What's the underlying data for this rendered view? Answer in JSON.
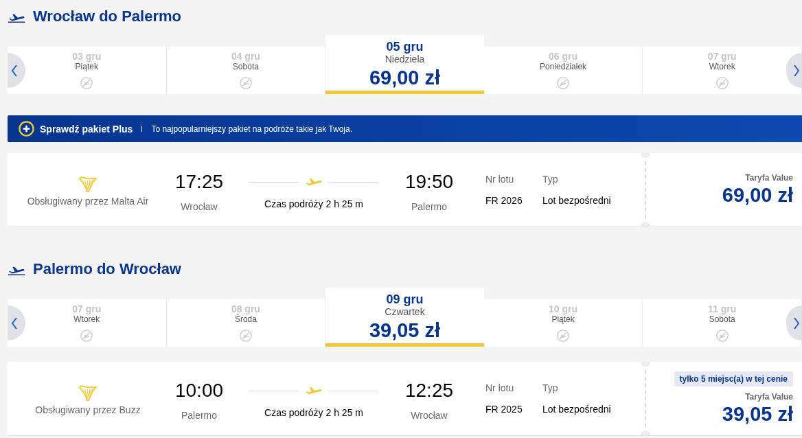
{
  "journeys": [
    {
      "title": "Wrocław do Palermo",
      "dates": [
        {
          "date": "03 gru",
          "day": "Piątek",
          "selected": false
        },
        {
          "date": "04 gru",
          "day": "Sobota",
          "selected": false
        },
        {
          "date": "05 gru",
          "day": "Niedziela",
          "selected": true,
          "price": "69,00 zł"
        },
        {
          "date": "06 gru",
          "day": "Poniedziałek",
          "selected": false
        },
        {
          "date": "07 gru",
          "day": "Wtorek",
          "selected": false
        }
      ],
      "promo": {
        "title": "Sprawdź pakiet Plus",
        "text": "To najpopularniejszy pakiet na podróże takie jak Twoja."
      },
      "flights": [
        {
          "operator": "Obsługiwany przez Malta Air",
          "departure_time": "17:25",
          "departure_city": "Wrocław",
          "duration": "Czas podróży 2 h 25 m",
          "arrival_time": "19:50",
          "arrival_city": "Palermo",
          "flight_number_label": "Nr lotu",
          "flight_number": "FR 2026",
          "type_label": "Typ",
          "type": "Lot bezpośredni",
          "fare": "Taryfa Value",
          "price": "69,00 zł"
        }
      ]
    },
    {
      "title": "Palermo do Wrocław",
      "dates": [
        {
          "date": "07 gru",
          "day": "Wtorek",
          "selected": false
        },
        {
          "date": "08 gru",
          "day": "Środa",
          "selected": false
        },
        {
          "date": "09 gru",
          "day": "Czwartek",
          "selected": true,
          "price": "39,05 zł"
        },
        {
          "date": "10 gru",
          "day": "Piątek",
          "selected": false
        },
        {
          "date": "11 gru",
          "day": "Sobota",
          "selected": false
        }
      ],
      "flights": [
        {
          "operator": "Obsługiwany przez Buzz",
          "departure_time": "10:00",
          "departure_city": "Palermo",
          "duration": "Czas podróży 2 h 25 m",
          "arrival_time": "12:25",
          "arrival_city": "Wrocław",
          "flight_number_label": "Nr lotu",
          "flight_number": "FR 2025",
          "type_label": "Typ",
          "type": "Lot bezpośredni",
          "badge": "tylko 5 miejsc(a) w tej cenie",
          "fare": "Taryfa Value",
          "price": "39,05 zł"
        }
      ]
    }
  ]
}
